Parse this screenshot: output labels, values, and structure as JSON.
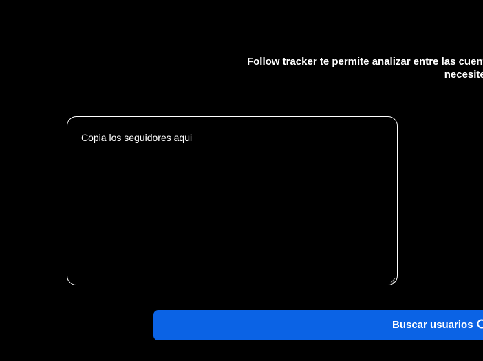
{
  "intro": {
    "line1": "Follow tracker te permite analizar entre las cuentas que sigues y las cuentas que te siguen",
    "line2": "necesites."
  },
  "followers_input": {
    "placeholder": "Copia los seguidores aqui",
    "value": ""
  },
  "search_button": {
    "label": "Buscar usuarios",
    "icon": "search-icon"
  },
  "colors": {
    "background": "#000000",
    "text": "#ffffff",
    "accent": "#0b63e5"
  }
}
